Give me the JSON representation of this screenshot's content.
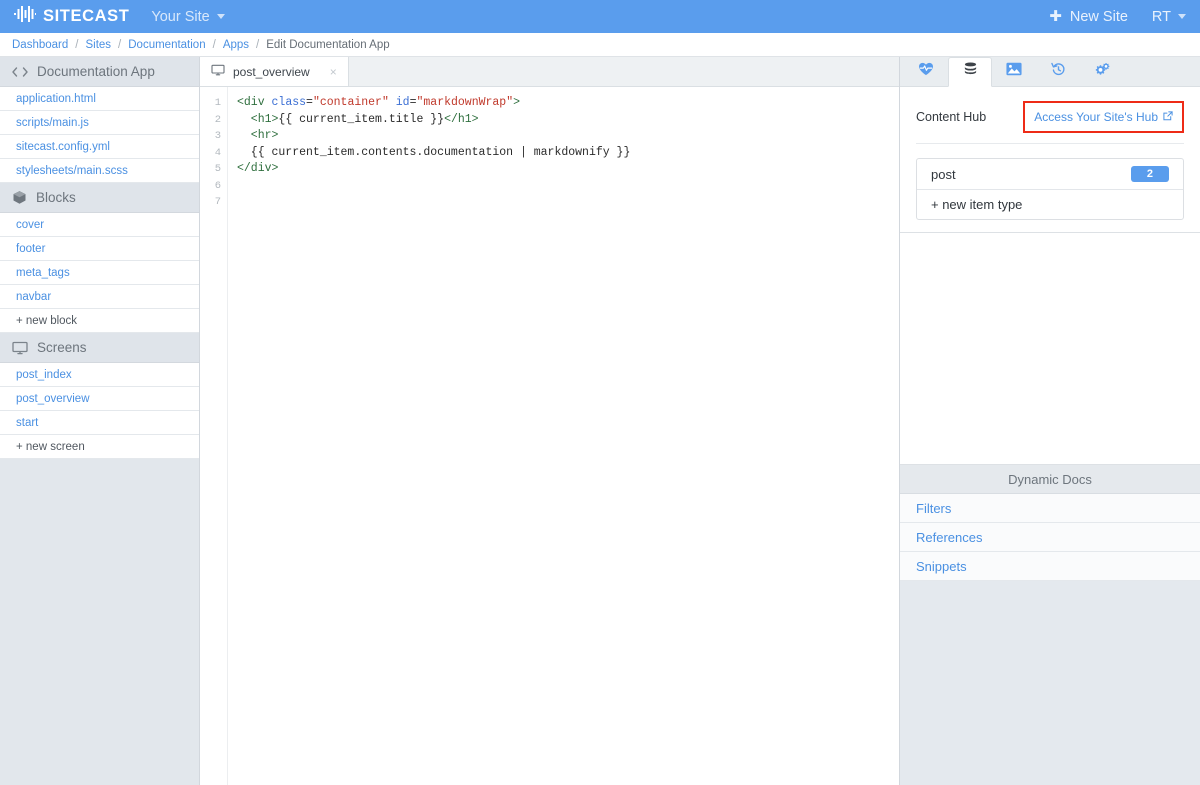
{
  "topbar": {
    "logo_icon": "audio-wave-icon",
    "brand": "SITECAST",
    "site_name": "Your Site",
    "new_site_label": "New Site",
    "new_site_icon": "plus-icon",
    "user_initials": "RT"
  },
  "breadcrumb": {
    "items": [
      {
        "label": "Dashboard",
        "current": false
      },
      {
        "label": "Sites",
        "current": false
      },
      {
        "label": "Documentation",
        "current": false
      },
      {
        "label": "Apps",
        "current": false
      },
      {
        "label": "Edit Documentation App",
        "current": true
      }
    ],
    "separator": "/"
  },
  "sidebar": {
    "sections": [
      {
        "title": "Documentation App",
        "icon": "code-brackets-icon",
        "items": [
          {
            "label": "application.html",
            "add": false
          },
          {
            "label": "scripts/main.js",
            "add": false
          },
          {
            "label": "sitecast.config.yml",
            "add": false
          },
          {
            "label": "stylesheets/main.scss",
            "add": false
          }
        ]
      },
      {
        "title": "Blocks",
        "icon": "cube-icon",
        "items": [
          {
            "label": "cover",
            "add": false
          },
          {
            "label": "footer",
            "add": false
          },
          {
            "label": "meta_tags",
            "add": false
          },
          {
            "label": "navbar",
            "add": false
          },
          {
            "label": "+ new block",
            "add": true
          }
        ]
      },
      {
        "title": "Screens",
        "icon": "monitor-icon",
        "items": [
          {
            "label": "post_index",
            "add": false
          },
          {
            "label": "post_overview",
            "add": false
          },
          {
            "label": "start",
            "add": false
          },
          {
            "label": "+ new screen",
            "add": true
          }
        ]
      }
    ]
  },
  "editor": {
    "tab": {
      "label": "post_overview",
      "icon": "monitor-icon",
      "close_label": "×"
    },
    "line_numbers": [
      "1",
      "2",
      "3",
      "4",
      "5",
      "6",
      "7"
    ],
    "code_lines": [
      [
        {
          "t": "tag",
          "s": "<div "
        },
        {
          "t": "attr",
          "s": "class"
        },
        {
          "t": "plain",
          "s": "="
        },
        {
          "t": "str",
          "s": "\"container\""
        },
        {
          "t": "plain",
          "s": " "
        },
        {
          "t": "attr",
          "s": "id"
        },
        {
          "t": "plain",
          "s": "="
        },
        {
          "t": "str",
          "s": "\"markdownWrap\""
        },
        {
          "t": "tag",
          "s": ">"
        }
      ],
      [
        {
          "t": "tag",
          "s": "  <h1>"
        },
        {
          "t": "plain",
          "s": "{{ current_item.title }}"
        },
        {
          "t": "tag",
          "s": "</h1>"
        }
      ],
      [
        {
          "t": "tag",
          "s": "  <hr>"
        }
      ],
      [
        {
          "t": "plain",
          "s": "  {{ current_item.contents.documentation | markdownify }}"
        }
      ],
      [
        {
          "t": "tag",
          "s": "</div>"
        }
      ],
      [],
      []
    ]
  },
  "right_panel": {
    "tabs": [
      {
        "icon": "heartbeat-icon",
        "active": false
      },
      {
        "icon": "database-icon",
        "active": true
      },
      {
        "icon": "image-icon",
        "active": false
      },
      {
        "icon": "history-clock-icon",
        "active": false
      },
      {
        "icon": "cogs-icon",
        "active": false
      }
    ],
    "content_hub": {
      "title": "Content Hub",
      "link_label": "Access Your Site's Hub",
      "link_icon": "external-link-icon",
      "highlight_color": "#ee2b17",
      "item_types": [
        {
          "label": "post",
          "count": "2",
          "add": false
        },
        {
          "label": "+ new item type",
          "count": null,
          "add": true
        }
      ]
    },
    "dynamic_docs": {
      "title": "Dynamic Docs",
      "items": [
        {
          "label": "Filters"
        },
        {
          "label": "References"
        },
        {
          "label": "Snippets"
        }
      ]
    }
  }
}
